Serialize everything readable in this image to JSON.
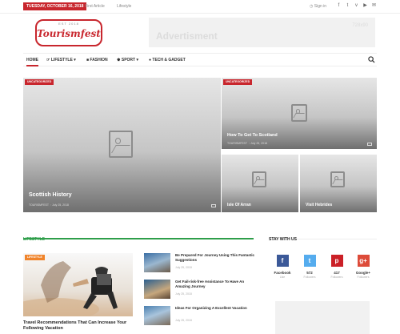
{
  "topbar": {
    "date": "TUESDAY, OCTOBER 16, 2018",
    "links": [
      "First Article",
      "Lifestyle"
    ],
    "signin": "Sign in",
    "social_icons": [
      "facebook-icon",
      "twitter-icon",
      "vimeo-icon",
      "youtube-icon",
      "email-icon"
    ]
  },
  "logo": {
    "since": "EST 2018",
    "name": "Tourismfest"
  },
  "ad": {
    "text": "Advertisment",
    "size": "728x90"
  },
  "nav": {
    "items": [
      "HOME",
      "LIFESTYLE",
      "FASHION",
      "SPORT",
      "TECH & GADGET"
    ]
  },
  "featured": {
    "main": {
      "category": "UNCATEGORIZED",
      "title": "Scottish History",
      "author": "TOURISMFEST",
      "date": "July 25, 2018"
    },
    "right_top": {
      "category": "UNCATEGORIZED",
      "title": "How To Get To Scotland",
      "author": "TOURISMFEST",
      "date": "July 25, 2018"
    },
    "bottom_left": {
      "title": "Isle Of Arran"
    },
    "bottom_right": {
      "title": "Visit Hebrides"
    }
  },
  "lifestyle": {
    "heading": "LIFESTYLE",
    "main": {
      "category": "LIFESTYLE",
      "title": "Travel Recommendations That Can Increase Your Following Vacation"
    },
    "side": [
      {
        "title": "Be Prepared For Journey Using This Fantastic Suggestions",
        "date": "July 25, 2018"
      },
      {
        "title": "Get Fail-risk-free Assistance To Have An Amazing Journey",
        "date": "July 25, 2018"
      },
      {
        "title": "Ideas For Organizing A Excellent Vacation",
        "date": "July 25, 2018"
      }
    ]
  },
  "stay": {
    "heading": "STAY WITH US",
    "networks": [
      {
        "icon": "f",
        "name": "Facebook",
        "label": "Like",
        "color": "#3b5998"
      },
      {
        "icon": "t",
        "name": "572",
        "label": "Followers",
        "color": "#55acee"
      },
      {
        "icon": "p",
        "name": "417",
        "label": "Followers",
        "color": "#cb2027"
      },
      {
        "icon": "g+",
        "name": "Google+",
        "label": "Followers",
        "color": "#dd4b39"
      }
    ]
  }
}
